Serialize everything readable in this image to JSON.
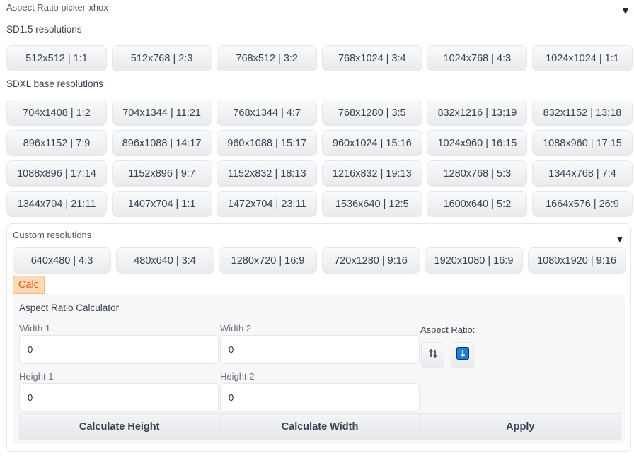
{
  "header": {
    "title": "Aspect Ratio picker-xhox"
  },
  "sd15": {
    "label": "SD1.5 resolutions",
    "buttons": [
      "512x512 | 1:1",
      "512x768 | 2:3",
      "768x512 | 3:2",
      "768x1024 | 3:4",
      "1024x768 | 4:3",
      "1024x1024 | 1:1"
    ]
  },
  "sdxl": {
    "label": "SDXL base resolutions",
    "buttons": [
      "704x1408 | 1:2",
      "704x1344 | 11:21",
      "768x1344 | 4:7",
      "768x1280 | 3:5",
      "832x1216 | 13:19",
      "832x1152 | 13:18",
      "896x1152 | 7:9",
      "896x1088 | 14:17",
      "960x1088 | 15:17",
      "960x1024 | 15:16",
      "1024x960 | 16:15",
      "1088x960 | 17:15",
      "1088x896 | 17:14",
      "1152x896 | 9:7",
      "1152x832 | 18:13",
      "1216x832 | 19:13",
      "1280x768 | 5:3",
      "1344x768 | 7:4",
      "1344x704 | 21:11",
      "1407x704 | 1:1",
      "1472x704 | 23:11",
      "1536x640 | 12:5",
      "1600x640 | 5:2",
      "1664x576 | 26:9"
    ]
  },
  "custom": {
    "title": "Custom resolutions",
    "buttons": [
      "640x480 | 4:3",
      "480x640 | 3:4",
      "1280x720 | 16:9",
      "720x1280 | 9:16",
      "1920x1080 | 16:9",
      "1080x1920 | 9:16"
    ]
  },
  "calc": {
    "tab_label": "Calc",
    "title": "Aspect Ratio Calculator",
    "width1_label": "Width 1",
    "width1_value": "0",
    "width2_label": "Width 2",
    "width2_value": "0",
    "height1_label": "Height 1",
    "height1_value": "0",
    "height2_label": "Height 2",
    "height2_value": "0",
    "aspect_ratio_label": "Aspect Ratio:",
    "swap_icon": "swap-vertical-icon",
    "copy_icon": "arrow-down-icon",
    "calc_height_label": "Calculate Height",
    "calc_width_label": "Calculate Width",
    "apply_label": "Apply"
  }
}
